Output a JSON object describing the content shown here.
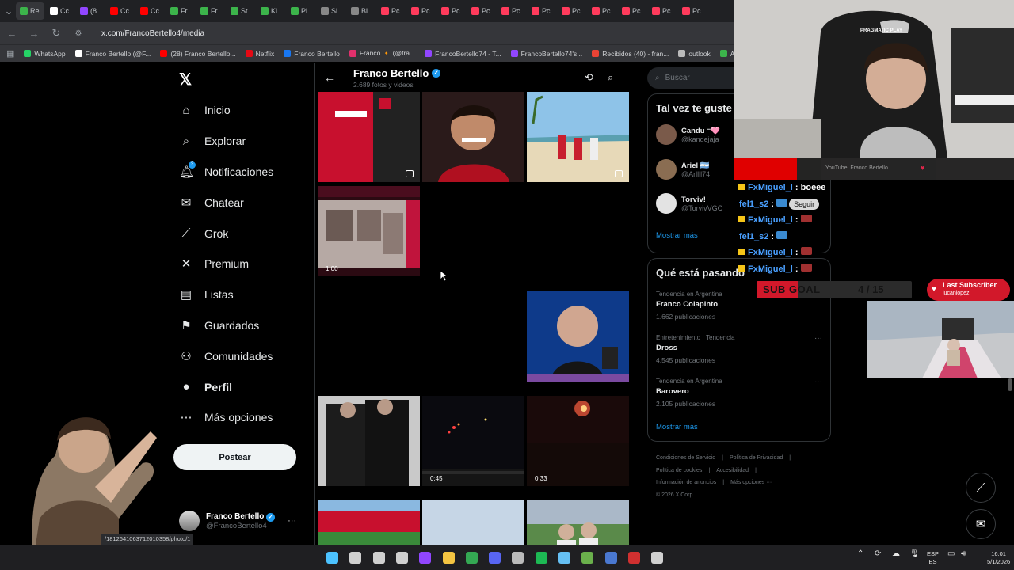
{
  "browser": {
    "tabs": [
      {
        "label": "Re",
        "color": "#3cb44b"
      },
      {
        "label": "Cc",
        "color": "#ffffff"
      },
      {
        "label": "(8",
        "color": "#9146ff"
      },
      {
        "label": "Cc",
        "color": "#ff0000"
      },
      {
        "label": "Cc",
        "color": "#ff0000"
      },
      {
        "label": "Fr",
        "color": "#3cb44b"
      },
      {
        "label": "Fr",
        "color": "#3cb44b"
      },
      {
        "label": "St",
        "color": "#3cb44b"
      },
      {
        "label": "Ki",
        "color": "#3cb44b"
      },
      {
        "label": "Pl",
        "color": "#3cb44b"
      },
      {
        "label": "Sl",
        "color": "#888888"
      },
      {
        "label": "Bl",
        "color": "#888888"
      },
      {
        "label": "Pc",
        "color": "#ff3b5c"
      },
      {
        "label": "Pc",
        "color": "#ff3b5c"
      },
      {
        "label": "Pc",
        "color": "#ff3b5c"
      },
      {
        "label": "Pc",
        "color": "#ff3b5c"
      },
      {
        "label": "Pc",
        "color": "#ff3b5c"
      },
      {
        "label": "Pc",
        "color": "#ff3b5c"
      },
      {
        "label": "Pc",
        "color": "#ff3b5c"
      },
      {
        "label": "Pc",
        "color": "#ff3b5c"
      },
      {
        "label": "Pc",
        "color": "#ff3b5c"
      },
      {
        "label": "Pc",
        "color": "#ff3b5c"
      },
      {
        "label": "Pc",
        "color": "#ff3b5c"
      }
    ],
    "url": "x.com/FrancoBertello4/media",
    "bookmarks": [
      {
        "label": "WhatsApp",
        "color": "#25d366"
      },
      {
        "label": "Franco Bertello (@F...",
        "color": "#ffffff"
      },
      {
        "label": "(28) Franco Bertello...",
        "color": "#ff0000"
      },
      {
        "label": "Netflix",
        "color": "#e50914"
      },
      {
        "label": "Franco Bertello",
        "color": "#1877f2"
      },
      {
        "label": "Franco 🔸 (@fra...",
        "color": "#e1306c"
      },
      {
        "label": "FrancoBertello74 - T...",
        "color": "#9146ff"
      },
      {
        "label": "FrancoBertello74's...",
        "color": "#9146ff"
      },
      {
        "label": "Recibidos (40) - fran...",
        "color": "#ea4335"
      },
      {
        "label": "outlook",
        "color": "#bbbbbb"
      },
      {
        "label": "Aler",
        "color": "#3cb44b"
      }
    ]
  },
  "nav": {
    "items": [
      {
        "label": "Inicio",
        "icon": "home-icon",
        "glyph": "⌂"
      },
      {
        "label": "Explorar",
        "icon": "search-icon",
        "glyph": "⌕"
      },
      {
        "label": "Notificaciones",
        "icon": "bell-icon",
        "glyph": "🔔︎"
      },
      {
        "label": "Chatear",
        "icon": "mail-icon",
        "glyph": "✉"
      },
      {
        "label": "Grok",
        "icon": "grok-icon",
        "glyph": "⟋"
      },
      {
        "label": "Premium",
        "icon": "x-icon",
        "glyph": "✕"
      },
      {
        "label": "Listas",
        "icon": "list-icon",
        "glyph": "▤"
      },
      {
        "label": "Guardados",
        "icon": "bookmark-icon",
        "glyph": "⚑"
      },
      {
        "label": "Comunidades",
        "icon": "communities-icon",
        "glyph": "⚇"
      },
      {
        "label": "Perfil",
        "icon": "profile-icon",
        "glyph": "●"
      },
      {
        "label": "Más opciones",
        "icon": "more-icon",
        "glyph": "⋯"
      }
    ],
    "notif_badge": "3",
    "post_button": "Postear",
    "profile": {
      "name": "Franco Bertello",
      "handle": "@FrancoBertello4"
    }
  },
  "status_url": "/1812641063712010358/photo/1",
  "main": {
    "title": "Franco Bertello",
    "subtitle": "2.689 fotos y videos",
    "tiles": [
      {
        "col": 0,
        "row": 0,
        "kind": "jersey",
        "multi": true
      },
      {
        "col": 1,
        "row": 0,
        "kind": "portrait"
      },
      {
        "col": 2,
        "row": 0,
        "kind": "beach",
        "multi": true
      },
      {
        "col": 0,
        "row": 1,
        "kind": "stream",
        "duration": "1:00"
      },
      {
        "col": 2,
        "row": 2,
        "kind": "press"
      },
      {
        "col": 0,
        "row": 3,
        "kind": "people"
      },
      {
        "col": 1,
        "row": 3,
        "kind": "fireworks",
        "duration": "0:45"
      },
      {
        "col": 2,
        "row": 3,
        "kind": "fireworks2",
        "duration": "0:33"
      },
      {
        "col": 0,
        "row": 4,
        "kind": "stadium"
      },
      {
        "col": 1,
        "row": 4,
        "kind": "sky"
      },
      {
        "col": 2,
        "row": 4,
        "kind": "kids"
      }
    ]
  },
  "right": {
    "search_placeholder": "Buscar",
    "suggest_title": "Tal vez te guste",
    "suggestions": [
      {
        "name": "Candu ⁻🩷",
        "handle": "@kandejaja",
        "color": "#7a5a4a"
      },
      {
        "name": "Ariel 🇦🇷",
        "handle": "@Arllll74",
        "color": "#8a6d52"
      },
      {
        "name": "Torviv!",
        "handle": "@TorvivVGC",
        "color": "#e3e3e3"
      }
    ],
    "show_more": "Mostrar más",
    "trends_title": "Qué está pasando",
    "trends": [
      {
        "category": "Tendencia en Argentina",
        "title": "Franco Colapinto",
        "count": "1.662 publicaciones"
      },
      {
        "category": "Entretenimiento · Tendencia",
        "title": "Dross",
        "count": "4.545 publicaciones"
      },
      {
        "category": "Tendencia en Argentina",
        "title": "Barovero",
        "count": "2.105 publicaciones"
      }
    ],
    "trends_more": "Mostrar más",
    "footer": [
      [
        "Condiciones de Servicio",
        "|",
        "Política de Privacidad",
        "|"
      ],
      [
        "Política de cookies",
        "|",
        "Accesibilidad",
        "|"
      ],
      [
        "Información de anuncios",
        "|",
        "Más opciones ···"
      ],
      [
        "© 2026 X Corp."
      ]
    ]
  },
  "overlay": {
    "yt_label": "YouTube: Franco Bertello",
    "chat": [
      {
        "user": "FxMiguel_l",
        "msg": "boeee",
        "crown": true
      },
      {
        "user": "fel1_s2",
        "msg": "",
        "crown": false,
        "seguir": "Seguir"
      },
      {
        "user": "FxMiguel_l",
        "msg": "",
        "crown": true
      },
      {
        "user": "fel1_s2",
        "msg": "",
        "crown": false
      },
      {
        "user": "FxMiguel_l",
        "msg": "",
        "crown": true
      },
      {
        "user": "FxMiguel_l",
        "msg": "",
        "crown": true
      }
    ],
    "sub_goal": {
      "label": "SUB GOAL",
      "current": 4,
      "target": 15,
      "display": "4 / 15"
    },
    "last_subscriber": {
      "label": "Last Subscriber",
      "name": "lucanlopez"
    },
    "brand": "PRAGMATIC PLAY"
  },
  "taskbar": {
    "lang": [
      "ESP",
      "ES"
    ],
    "time": "16:01",
    "date": "5/1/2026",
    "apps": [
      {
        "name": "windows-start-icon",
        "color": "#4cc2ff"
      },
      {
        "name": "search-icon",
        "color": "#d0d0d0"
      },
      {
        "name": "task-view-icon",
        "color": "#d0d0d0"
      },
      {
        "name": "widgets-icon",
        "color": "#d0d0d0"
      },
      {
        "name": "twitch-icon",
        "color": "#9146ff"
      },
      {
        "name": "file-explorer-icon",
        "color": "#f5c542"
      },
      {
        "name": "chrome-icon",
        "color": "#34a853"
      },
      {
        "name": "discord-icon",
        "color": "#5865f2"
      },
      {
        "name": "obs-icon",
        "color": "#bbbbbb"
      },
      {
        "name": "spotify-icon",
        "color": "#1db954"
      },
      {
        "name": "steam-icon",
        "color": "#66c0f4"
      },
      {
        "name": "app-icon",
        "color": "#6ab04c"
      },
      {
        "name": "monitor-icon",
        "color": "#4a78d0"
      },
      {
        "name": "game-icon",
        "color": "#d03030"
      },
      {
        "name": "audio-icon",
        "color": "#d0d0d0"
      }
    ]
  }
}
